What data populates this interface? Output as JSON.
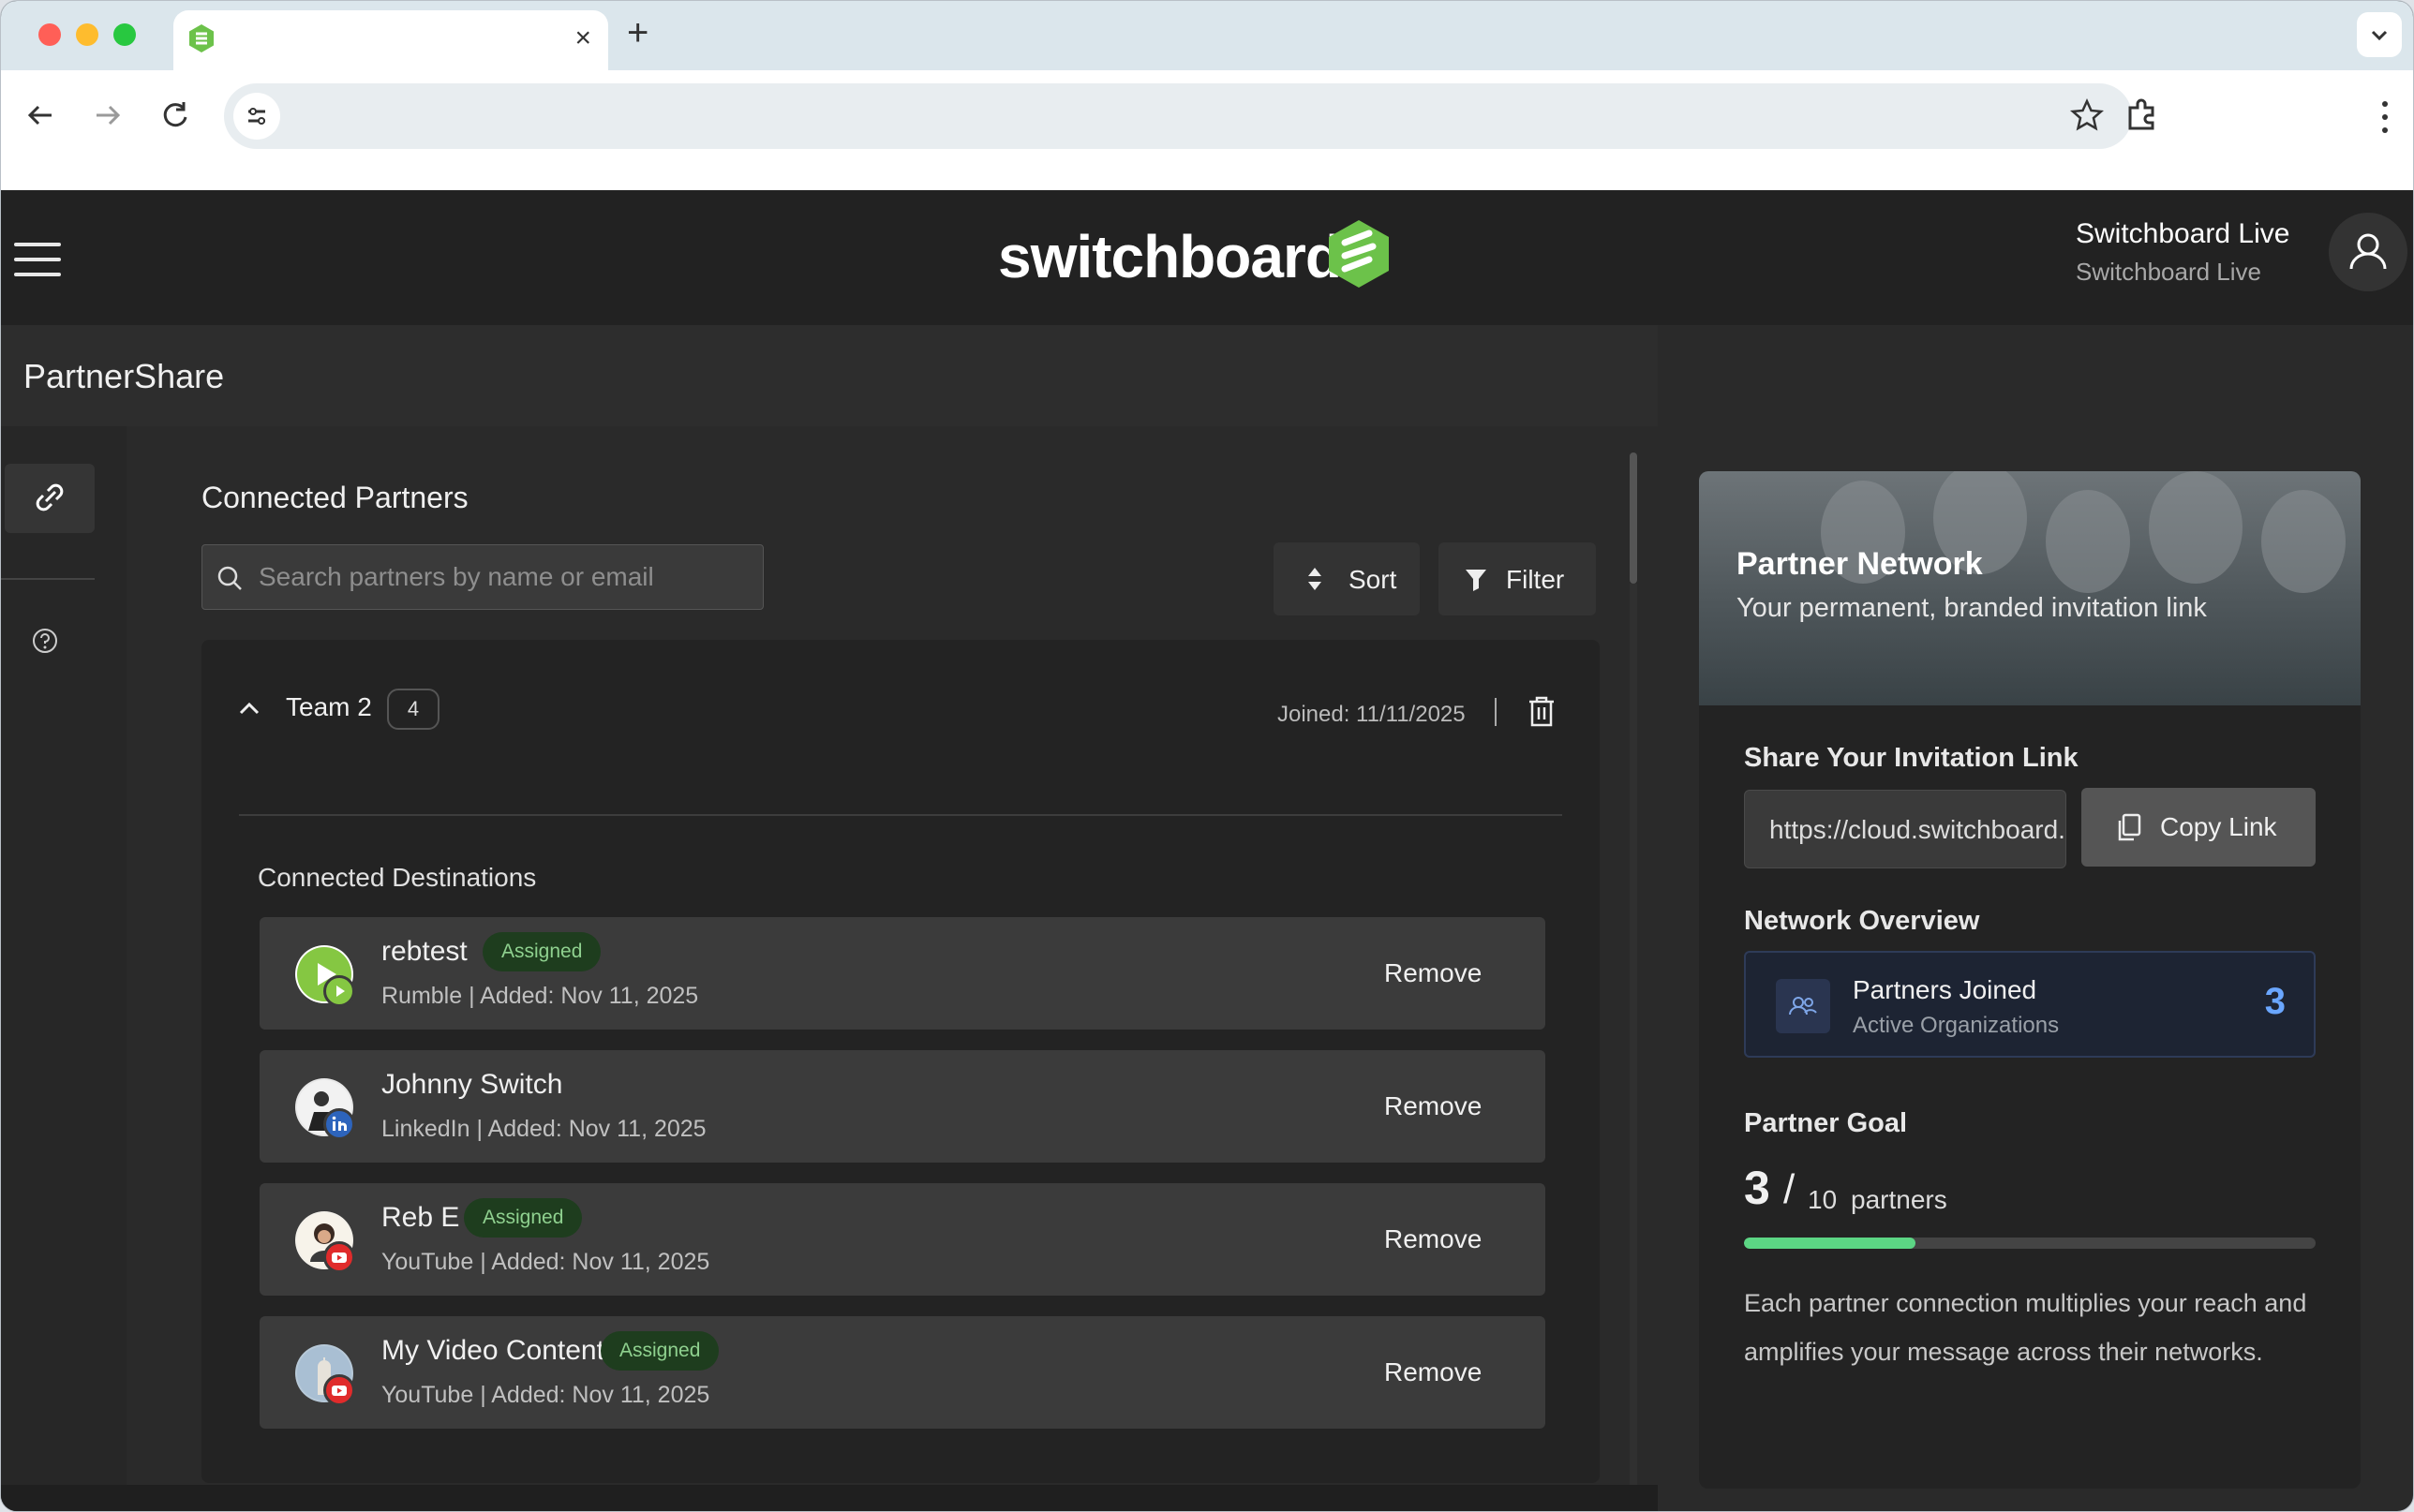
{
  "browser": {
    "tab_title": "",
    "address": "",
    "colors": {
      "close": "#ff5f57",
      "minimize": "#febc2e",
      "zoom": "#28c840"
    }
  },
  "header": {
    "logo_text": "switchboard",
    "account_name": "Switchboard Live",
    "account_sub": "Switchboard Live",
    "brand_color": "#6cc24a"
  },
  "page": {
    "title": "PartnerShare"
  },
  "partners": {
    "title": "Connected Partners",
    "search_placeholder": "Search partners by name or email",
    "sort_label": "Sort",
    "filter_label": "Filter",
    "team": {
      "name": "Team 2",
      "count": "4",
      "joined": "Joined: 11/11/2025",
      "destinations_title": "Connected Destinations",
      "destinations": [
        {
          "name": "rebtest",
          "assigned": "Assigned",
          "meta": "Rumble | Added: Nov 11, 2025",
          "remove": "Remove",
          "platform_icon": "rumble-icon"
        },
        {
          "name": "Johnny Switch",
          "assigned": "",
          "meta": "LinkedIn | Added: Nov 11, 2025",
          "remove": "Remove",
          "platform_icon": "linkedin-icon"
        },
        {
          "name": "Reb E",
          "assigned": "Assigned",
          "meta": "YouTube | Added: Nov 11, 2025",
          "remove": "Remove",
          "platform_icon": "youtube-icon"
        },
        {
          "name": "My Video Content",
          "assigned": "Assigned",
          "meta": "YouTube | Added: Nov 11, 2025",
          "remove": "Remove",
          "platform_icon": "youtube-icon"
        }
      ]
    }
  },
  "network": {
    "hero_title": "Partner Network",
    "hero_subtitle": "Your permanent, branded invitation link",
    "share_label": "Share Your Invitation Link",
    "link_value": "https://cloud.switchboard.live",
    "copy_label": "Copy Link",
    "overview_label": "Network Overview",
    "overview_title": "Partners Joined",
    "overview_sub": "Active Organizations",
    "overview_count": "3",
    "goal_label": "Partner Goal",
    "goal_current": "3",
    "goal_slash": "/",
    "goal_max": "10",
    "goal_unit": "partners",
    "goal_progress": 0.3,
    "goal_desc": "Each partner connection multiplies your reach and amplifies your message across their networks."
  }
}
